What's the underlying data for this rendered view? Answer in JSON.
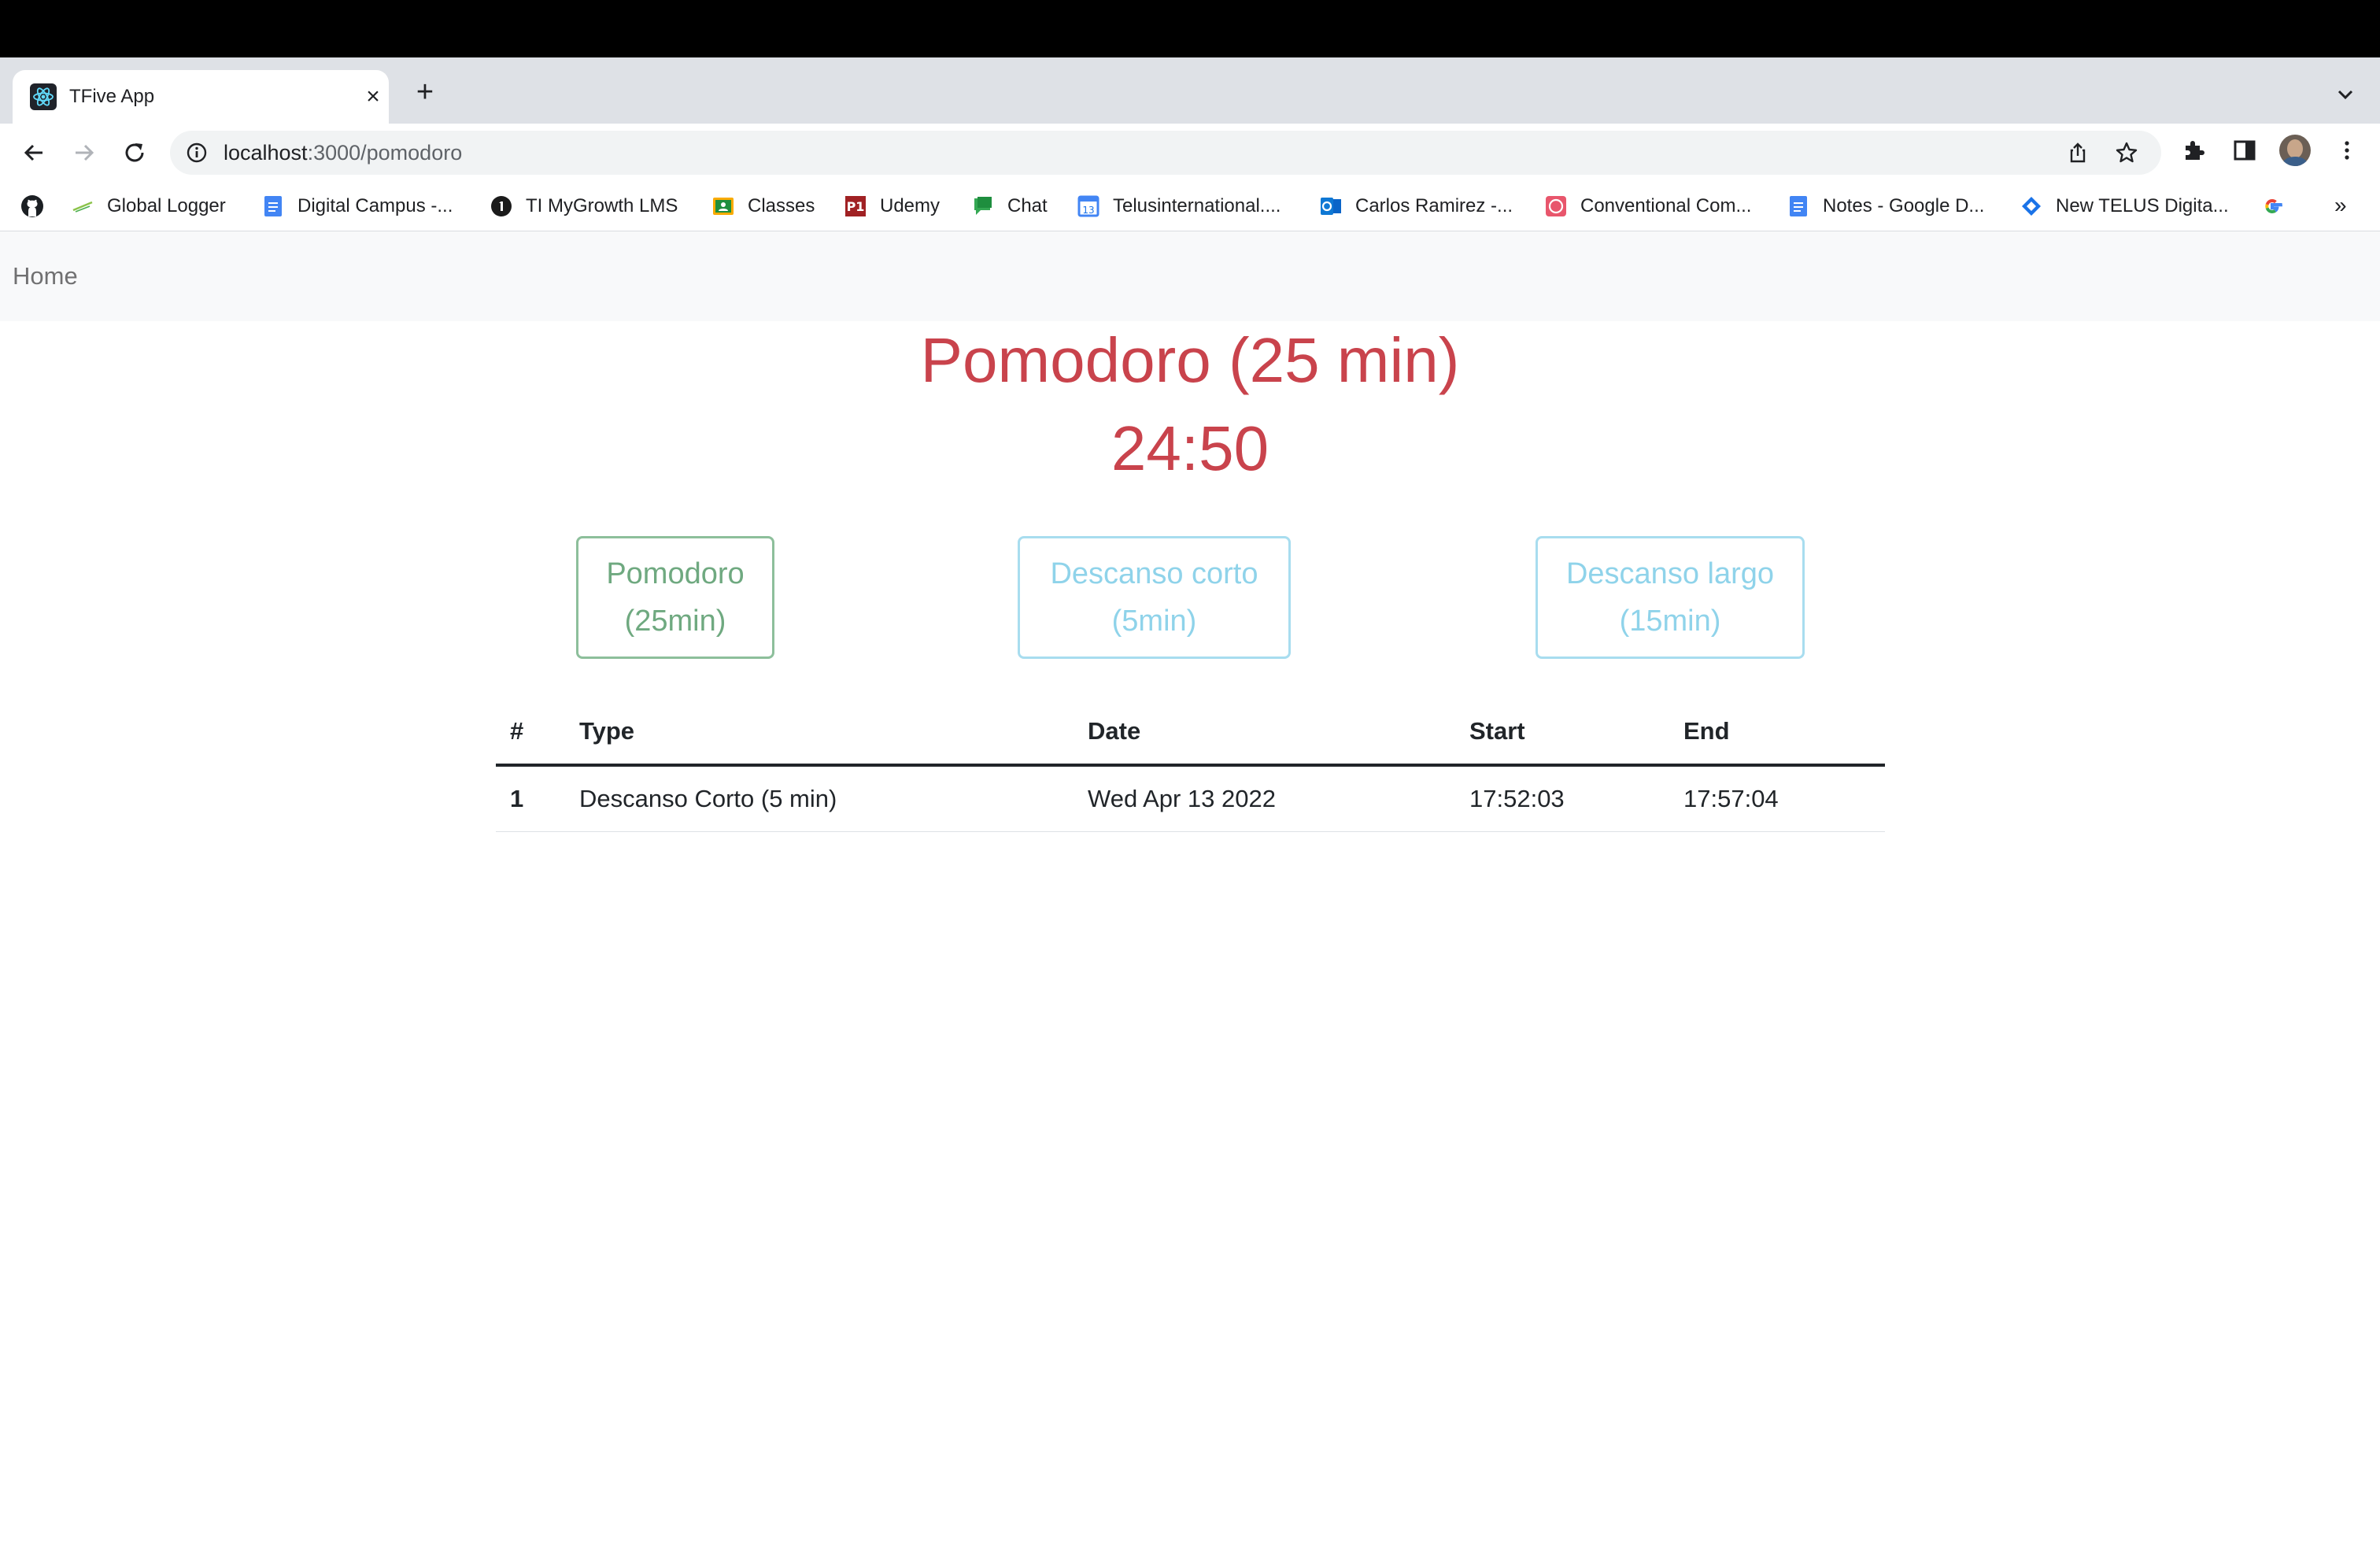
{
  "browser": {
    "tab": {
      "title": "TFive App"
    },
    "url": {
      "host": "localhost",
      "path": ":3000/pomodoro"
    },
    "bookmarks": [
      {
        "label": "",
        "icon": "github-icon"
      },
      {
        "label": "Global Logger",
        "icon": "global-logger-icon"
      },
      {
        "label": "Digital Campus -...",
        "icon": "google-docs-icon"
      },
      {
        "label": "TI MyGrowth LMS",
        "icon": "mygrowth-icon"
      },
      {
        "label": "Classes",
        "icon": "classroom-icon"
      },
      {
        "label": "Udemy",
        "icon": "udemy-icon"
      },
      {
        "label": "Chat",
        "icon": "google-chat-icon"
      },
      {
        "label": "Telusinternational....",
        "icon": "calendar-icon"
      },
      {
        "label": "Carlos Ramirez -...",
        "icon": "outlook-icon"
      },
      {
        "label": "Conventional Com...",
        "icon": "conventional-icon"
      },
      {
        "label": "Notes - Google D...",
        "icon": "google-docs-icon"
      },
      {
        "label": "New TELUS Digita...",
        "icon": "telus-diamond-icon"
      },
      {
        "label": "",
        "icon": "google-icon"
      }
    ],
    "more": "»"
  },
  "navbar": {
    "home": "Home"
  },
  "timer": {
    "mode_title": "Pomodoro (25 min)",
    "time_left": "24:50"
  },
  "modes": [
    {
      "line1": "Pomodoro",
      "line2": "(25min)",
      "color": "#6fa980"
    },
    {
      "line1": "Descanso corto",
      "line2": "(5min)",
      "color": "#8fd3ea"
    },
    {
      "line1": "Descanso largo",
      "line2": "(15min)",
      "color": "#8fd3ea"
    }
  ],
  "history": {
    "columns": [
      "#",
      "Type",
      "Date",
      "Start",
      "End"
    ],
    "rows": [
      [
        "1",
        "Descanso Corto (5 min)",
        "Wed Apr 13 2022",
        "17:52:03",
        "17:57:04"
      ]
    ]
  },
  "colors": {
    "accent": "#c9434c",
    "navbar_bg": "#f8f9fa"
  }
}
